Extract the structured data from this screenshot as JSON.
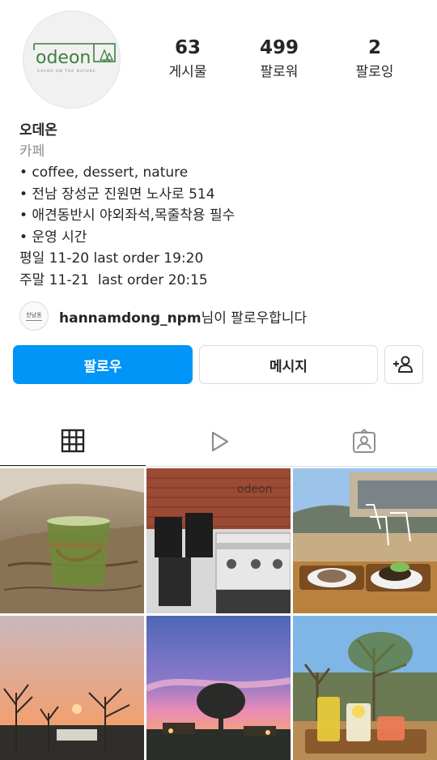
{
  "profile": {
    "logo_text": "odeon",
    "logo_tagline": "SAVOR ON THE NATURE",
    "stats": [
      {
        "count": "63",
        "label": "게시물"
      },
      {
        "count": "499",
        "label": "팔로워"
      },
      {
        "count": "2",
        "label": "팔로잉"
      }
    ],
    "name": "오데온",
    "category": "카페",
    "bio_lines": [
      "• coffee, dessert, nature",
      "• 전남 장성군 진원면 노사로 514",
      "• 애견동반시 야외좌석,목줄착용 필수",
      "• 운영 시간",
      "평일 11-20 last order 19:20",
      "주말 11-21  last order 20:15"
    ]
  },
  "followed_by": {
    "avatar_text": "한남동",
    "username": "hannamdong_npm",
    "suffix": "님이 팔로우합니다"
  },
  "actions": {
    "follow_label": "팔로우",
    "message_label": "메시지",
    "add_user_icon": "person-add-icon"
  },
  "tabs": [
    {
      "icon": "grid-icon",
      "active": true
    },
    {
      "icon": "reels-icon",
      "active": false
    },
    {
      "icon": "tagged-icon",
      "active": false
    }
  ],
  "posts": [
    {
      "subject": "matcha latte on tree stump"
    },
    {
      "subject": "espresso machine and brick wall"
    },
    {
      "subject": "outdoor seating with desserts"
    },
    {
      "subject": "sunset over trees"
    },
    {
      "subject": "pink sky over garden"
    },
    {
      "subject": "drinks on wooden tray"
    }
  ],
  "colors": {
    "accent": "#0095f6",
    "brand_green": "#3f7f3f"
  }
}
